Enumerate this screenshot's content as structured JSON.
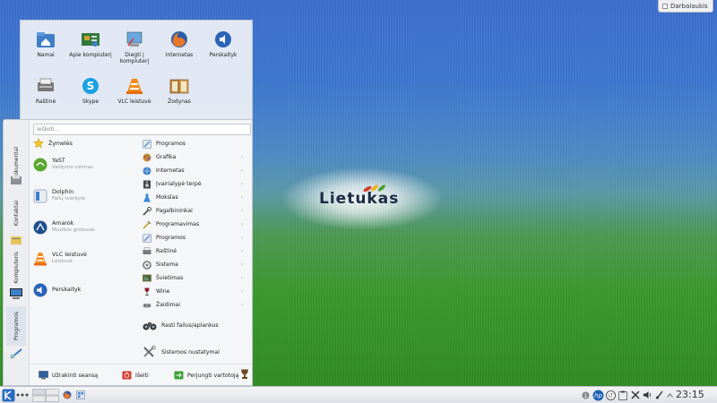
{
  "desktop": {
    "logo_text": "Lietukas",
    "top_button_label": "Darbalaukis"
  },
  "folderview": {
    "items": [
      {
        "label": "Namai",
        "icon": "home-folder-icon"
      },
      {
        "label": "Apie kompiuterį",
        "icon": "about-computer-icon"
      },
      {
        "label": "Diegti į kompiuterį",
        "icon": "install-icon"
      },
      {
        "label": "Internetas",
        "icon": "firefox-icon"
      },
      {
        "label": "Perskaityk",
        "icon": "speaker-icon"
      },
      {
        "label": "Raštinė",
        "icon": "office-icon"
      },
      {
        "label": "Skype",
        "icon": "skype-icon"
      },
      {
        "label": "VLC leistuvė",
        "icon": "vlc-icon"
      },
      {
        "label": "Žodynas",
        "icon": "dictionary-icon"
      }
    ]
  },
  "kickoff": {
    "search_placeholder": "Ieškoti...",
    "tabs": [
      {
        "label": "Dokumentai",
        "icon": "documents-icon"
      },
      {
        "label": "Kontaktai",
        "icon": "contacts-icon"
      },
      {
        "label": "Kompiuteris",
        "icon": "computer-icon"
      },
      {
        "label": "Programos",
        "icon": "applications-icon"
      }
    ],
    "favorites_header": "Žymelės",
    "favorites": [
      {
        "title": "YaST",
        "subtitle": "Valdymo centras",
        "icon": "yast-icon"
      },
      {
        "title": "Dolphin",
        "subtitle": "Failų tvarkytė",
        "icon": "dolphin-icon"
      },
      {
        "title": "Amarok",
        "subtitle": "Muzikos grotuvas",
        "icon": "amarok-icon"
      },
      {
        "title": "VLC leistuvė",
        "subtitle": "Leistuvė",
        "icon": "vlc-icon"
      },
      {
        "title": "Perskaityk",
        "subtitle": "",
        "icon": "speaker-icon"
      }
    ],
    "categories": [
      {
        "label": "Programos",
        "icon": "applications-icon"
      },
      {
        "label": "Grafika",
        "icon": "graphics-icon"
      },
      {
        "label": "Internetas",
        "icon": "internet-icon"
      },
      {
        "label": "Įvairialypė terpė",
        "icon": "multimedia-icon"
      },
      {
        "label": "Mokslas",
        "icon": "science-icon"
      },
      {
        "label": "Pagalbininkai",
        "icon": "utilities-icon"
      },
      {
        "label": "Programavimas",
        "icon": "development-icon"
      },
      {
        "label": "Programos",
        "icon": "applications-icon"
      },
      {
        "label": "Raštinė",
        "icon": "office-icon"
      },
      {
        "label": "Sistema",
        "icon": "system-icon"
      },
      {
        "label": "Švietimas",
        "icon": "education-icon"
      },
      {
        "label": "Wine",
        "icon": "wine-icon"
      },
      {
        "label": "Žaidimai",
        "icon": "games-icon"
      }
    ],
    "find_files": "Rasti failus/aplankus",
    "system_settings": "Sistemos nustatymai",
    "bottom": {
      "lock": "Užrakinti seansą",
      "logout": "Išeiti",
      "switch_user": "Perjungti vartotoją"
    }
  },
  "taskbar": {
    "clock": "23:15"
  }
}
